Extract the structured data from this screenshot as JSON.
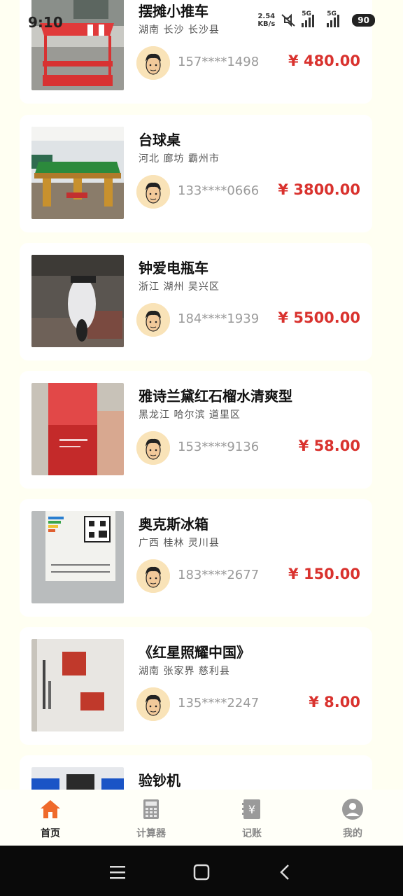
{
  "status": {
    "time": "9:10",
    "net_speed_value": "2.54",
    "net_speed_unit": "KB/s",
    "signal1": "5G",
    "signal2": "5G",
    "battery": "90"
  },
  "listings": [
    {
      "title": "摆摊小推车",
      "location": "湖南 长沙 长沙县",
      "phone": "157****1498",
      "price": "¥ 480.00",
      "thumb": "cart"
    },
    {
      "title": "台球桌",
      "location": "河北 廊坊 霸州市",
      "phone": "133****0666",
      "price": "¥ 3800.00",
      "thumb": "pool"
    },
    {
      "title": "钟爱电瓶车",
      "location": "浙江 湖州 吴兴区",
      "phone": "184****1939",
      "price": "¥ 5500.00",
      "thumb": "scooter"
    },
    {
      "title": "雅诗兰黛红石榴水清爽型",
      "location": "黑龙江 哈尔滨 道里区",
      "phone": "153****9136",
      "price": "¥ 58.00",
      "thumb": "bottle"
    },
    {
      "title": "奥克斯冰箱",
      "location": "广西 桂林 灵川县",
      "phone": "183****2677",
      "price": "¥ 150.00",
      "thumb": "fridge"
    },
    {
      "title": "《红星照耀中国》",
      "location": "湖南 张家界 慈利县",
      "phone": "135****2247",
      "price": "¥ 8.00",
      "thumb": "book"
    },
    {
      "title": "验钞机",
      "location": "",
      "phone": "",
      "price": "",
      "thumb": "machine"
    }
  ],
  "tabs": [
    {
      "label": "首页",
      "icon": "home-icon",
      "active": true
    },
    {
      "label": "计算器",
      "icon": "calculator-icon",
      "active": false
    },
    {
      "label": "记账",
      "icon": "ledger-icon",
      "active": false
    },
    {
      "label": "我的",
      "icon": "profile-icon",
      "active": false
    }
  ],
  "colors": {
    "price": "#d9322e",
    "accent": "#ef6a2b",
    "background": "#fffff2"
  }
}
